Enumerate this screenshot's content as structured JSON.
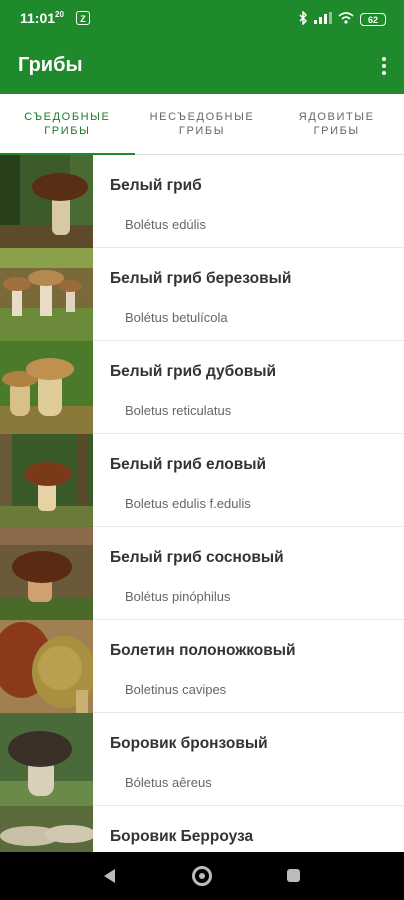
{
  "status": {
    "time": "11:01",
    "time_sup": "20",
    "app_icon": "Z",
    "battery": "62",
    "icons": [
      "bluetooth-icon",
      "signal-icon",
      "wifi-icon",
      "battery-icon"
    ]
  },
  "app_bar": {
    "title": "Грибы",
    "menu_icon": "overflow-menu-icon"
  },
  "tabs": [
    {
      "label": "СЪЕДОБНЫЕ\nГРИБЫ",
      "active": true
    },
    {
      "label": "НЕСЪЕДОБНЫЕ\nГРИБЫ",
      "active": false
    },
    {
      "label": "ЯДОВИТЫЕ\nГРИБЫ",
      "active": false
    }
  ],
  "items": [
    {
      "title": "Белый гриб",
      "latin": "Bolétus edúlis"
    },
    {
      "title": "Белый гриб березовый",
      "latin": "Bolétus betulícola"
    },
    {
      "title": "Белый гриб дубовый",
      "latin": "Boletus reticulatus"
    },
    {
      "title": "Белый гриб еловый",
      "latin": "Boletus edulis f.edulis"
    },
    {
      "title": "Белый гриб сосновый",
      "latin": "Bolétus pinóphilus"
    },
    {
      "title": "Болетин полоножковый",
      "latin": "Boletinus cavipes"
    },
    {
      "title": "Боровик бронзовый",
      "latin": "Bóletus aêreus"
    },
    {
      "title": "Боровик Берроуза",
      "latin": ""
    }
  ],
  "colors": {
    "primary": "#1f8a2c",
    "title_text": "#333333",
    "subtitle_text": "#666666"
  }
}
